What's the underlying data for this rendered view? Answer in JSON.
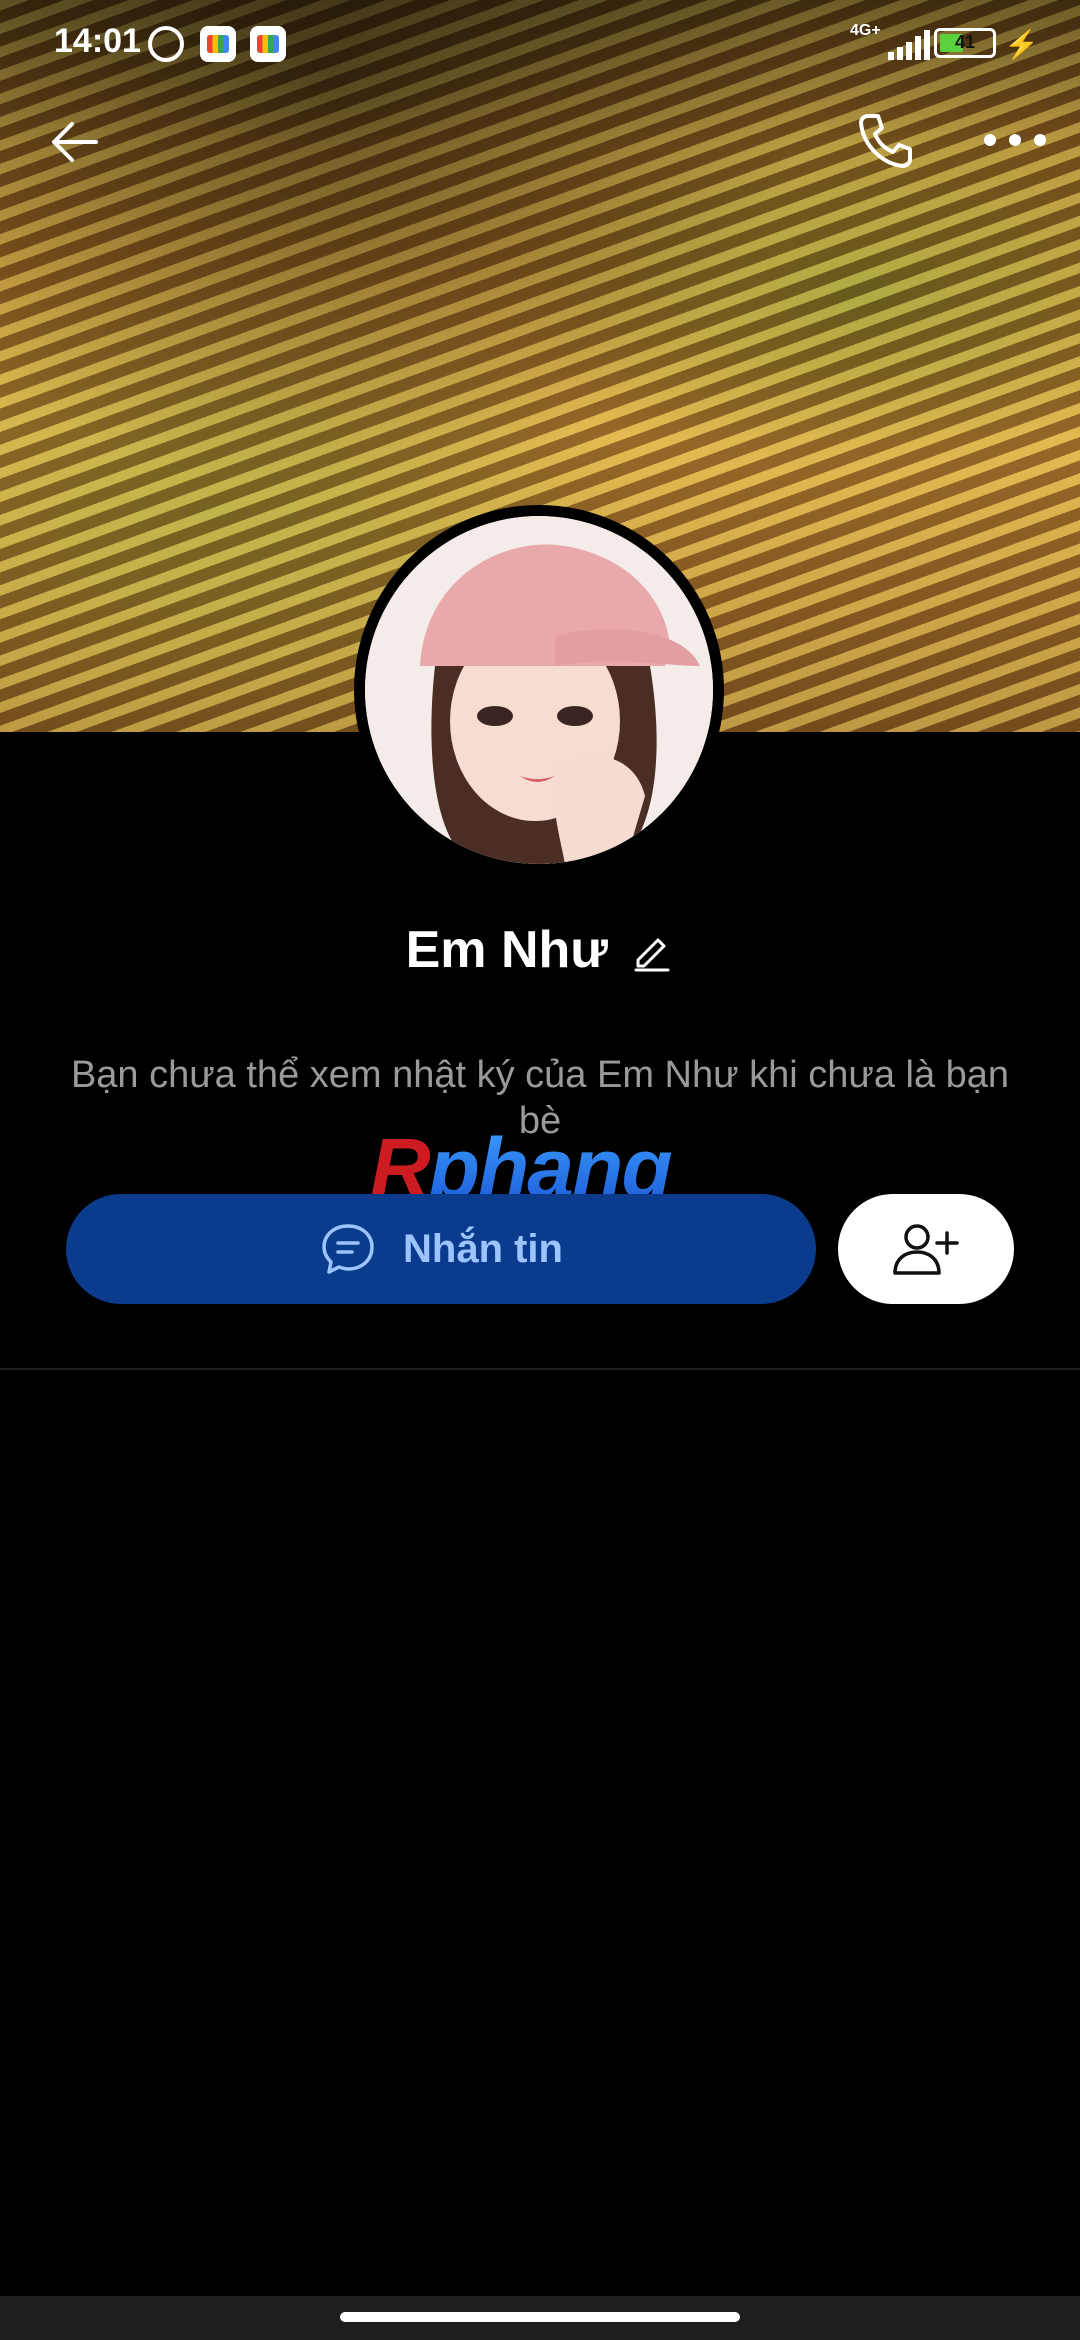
{
  "status_bar": {
    "time": "14:01",
    "network": "4G+",
    "battery_level": "41"
  },
  "profile": {
    "name": "Em Như",
    "notice": "Bạn chưa thể xem nhật ký của Em Như khi chưa là bạn bè"
  },
  "watermark": {
    "text": "Rphang"
  },
  "actions": {
    "message_label": "Nhắn tin"
  },
  "icons": {
    "back": "arrow-left",
    "call": "phone",
    "more": "more-horizontal",
    "edit": "pencil",
    "message": "chat-bubble",
    "add_friend": "user-plus"
  },
  "colors": {
    "background": "#000000",
    "message_button": "#0b3b8c",
    "message_label": "#9cc4ff",
    "add_button": "#ffffff",
    "notice_text": "#9a9a9a"
  }
}
